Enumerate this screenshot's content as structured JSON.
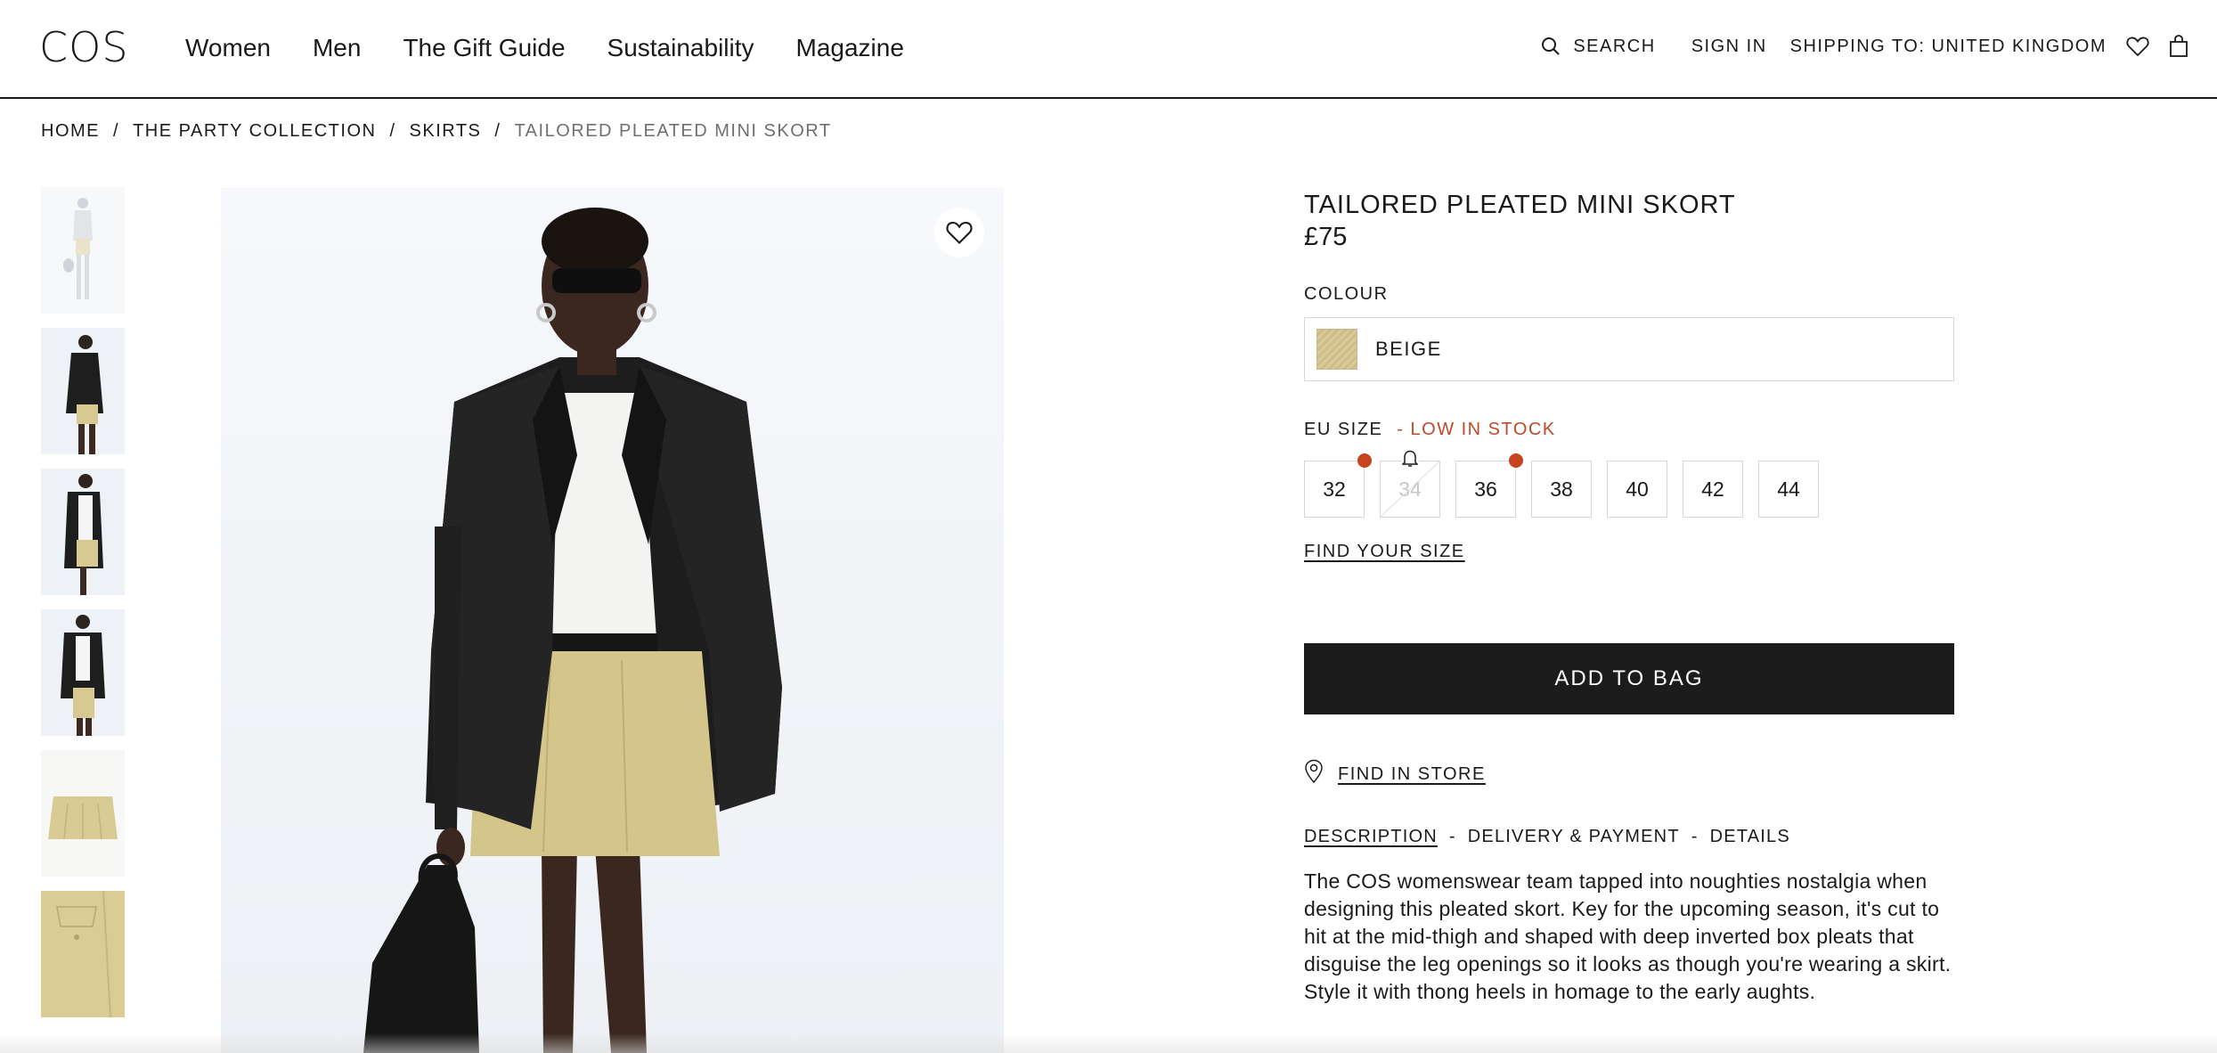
{
  "header": {
    "logo": "COS",
    "nav": [
      "Women",
      "Men",
      "The Gift Guide",
      "Sustainability",
      "Magazine"
    ],
    "search_label": "SEARCH",
    "sign_in": "SIGN IN",
    "shipping": "SHIPPING TO: UNITED KINGDOM",
    "icons": [
      "search-icon",
      "heart-icon",
      "bag-icon"
    ]
  },
  "breadcrumb": [
    "HOME",
    "THE PARTY COLLECTION",
    "SKIRTS",
    "TAILORED PLEATED MINI SKORT"
  ],
  "product": {
    "title": "TAILORED PLEATED MINI SKORT",
    "price": "£75",
    "colour_label": "COLOUR",
    "colour_value": "BEIGE",
    "size_label": "EU SIZE",
    "stock_note": "- LOW IN STOCK",
    "sizes": [
      "32",
      "34",
      "36",
      "38",
      "40",
      "42",
      "44"
    ],
    "find_size": "FIND YOUR SIZE",
    "add_to_bag": "ADD TO BAG",
    "find_in_store": "FIND IN STORE",
    "tabs": [
      "DESCRIPTION",
      "DELIVERY & PAYMENT",
      "DETAILS"
    ],
    "tab_separator": "-",
    "description": "The COS womenswear team tapped into noughties nostalgia when designing this pleated skort. Key for the upcoming season, it's cut to hit at the mid-thigh and shaped with deep inverted box pleats that disguise the leg openings so it looks as though you're wearing a skirt. Style it with thong heels in homage to the early aughts."
  },
  "colors": {
    "text": "#1a1a1a",
    "stock_warning": "#c0482b",
    "button_bg": "#1c1c1c",
    "swatch": "#d9c99a"
  }
}
